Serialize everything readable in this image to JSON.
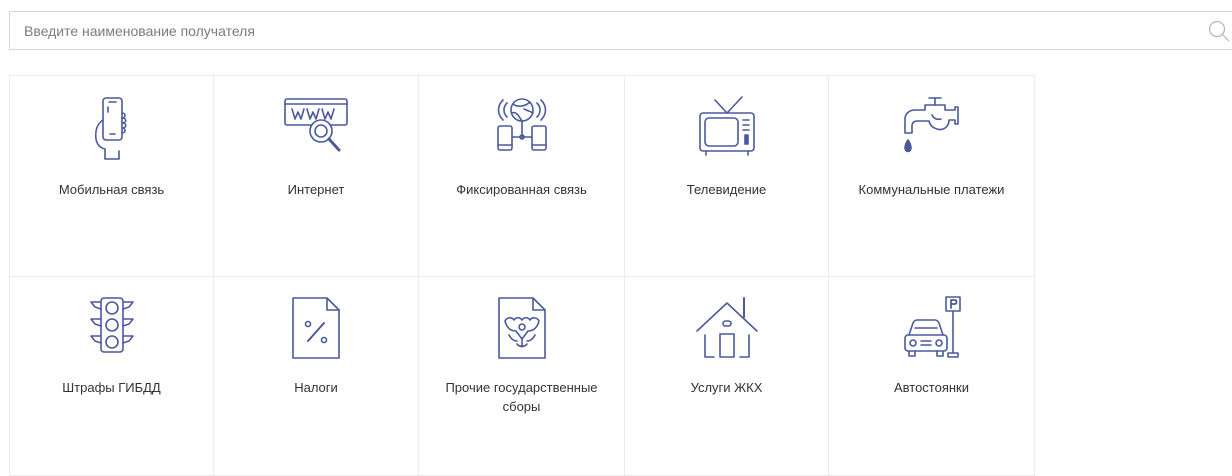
{
  "search": {
    "placeholder": "Введите наименование получателя"
  },
  "categories": [
    {
      "label": "Мобильная связь",
      "icon": "mobile-phone-icon"
    },
    {
      "label": "Интернет",
      "icon": "www-search-icon"
    },
    {
      "label": "Фиксированная связь",
      "icon": "fixed-network-icon"
    },
    {
      "label": "Телевидение",
      "icon": "tv-icon"
    },
    {
      "label": "Коммунальные платежи",
      "icon": "water-tap-icon"
    },
    {
      "label": "Штрафы ГИБДД",
      "icon": "traffic-light-icon"
    },
    {
      "label": "Налоги",
      "icon": "tax-document-icon"
    },
    {
      "label": "Прочие государственные сборы",
      "icon": "state-emblem-document-icon"
    },
    {
      "label": "Услуги ЖКХ",
      "icon": "house-icon"
    },
    {
      "label": "Автостоянки",
      "icon": "car-parking-icon"
    }
  ],
  "colors": {
    "icon": "#4a5a9c",
    "text": "#333333",
    "border": "#ececec",
    "placeholder": "#7c7c7c"
  }
}
